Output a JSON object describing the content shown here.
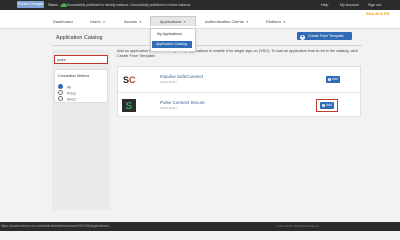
{
  "status_bar": {
    "publish_changes": "Publish Changes",
    "status_label": "Status",
    "status_message": "Successfully published to identity instance. Successfully published to mixed instance.",
    "help": "Help",
    "my_account": "My Account",
    "sign_out": "Sign out"
  },
  "header": {
    "logo_text": "SSA-M & PS"
  },
  "nav": {
    "dashboard": "Dashboard",
    "users": "Users",
    "access": "Access",
    "applications": "Applications",
    "authentication_clients": "Authentication Clients",
    "platform": "Platform"
  },
  "applications_menu": {
    "items": [
      "My Applications",
      "Application Catalog"
    ],
    "selected": "Application Catalog"
  },
  "page": {
    "title": "Application Catalog",
    "create_template_button": "Create From Template",
    "intro": "Add an application from the catalog to My Applications to enable it for single sign-on (SSO). To add an application that is not in the catalog, click Create From Template."
  },
  "filters": {
    "search_value": "pulse",
    "connection_method_title": "Connection Method",
    "options": [
      "All",
      "Proxy",
      "Direct"
    ],
    "selected_option": "All"
  },
  "catalog": {
    "rows": [
      {
        "name": "Impulse SafeConnect",
        "type": "SAML Direct",
        "logo_text": "S",
        "logo_accent": "C",
        "add_label": "Add"
      },
      {
        "name": "Pulse Connect Secure",
        "type": "SAML Direct",
        "logo_text": "S",
        "add_label": "Add"
      }
    ]
  },
  "footer": {
    "url": "https://access.tdemo.us.com/admin/interface/customer/SSO/MyApplications/...",
    "copyright": "© 2013-2018 | All Rights Reserved"
  },
  "colors": {
    "accent_blue": "#2f6cb5",
    "highlight_red": "#c0392b",
    "dark_bar": "#2b2b2b",
    "logo_orange": "#f39c12"
  }
}
